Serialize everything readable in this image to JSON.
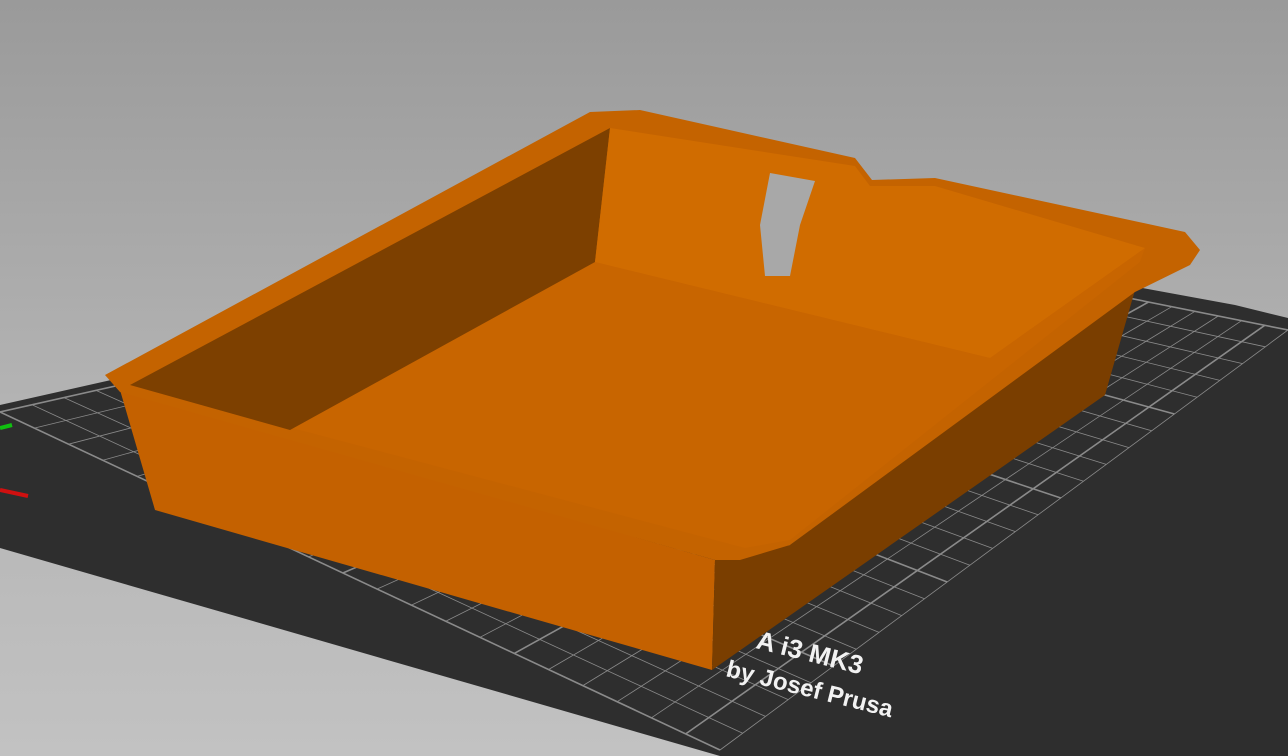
{
  "viewport": {
    "bed_label_line1": "A i3 MK3",
    "bed_label_line2": "by Josef Prusa"
  },
  "colors": {
    "background_top": "#9a9a9a",
    "bed": "#2f2f2f",
    "grid": "#8a8a8a",
    "model_light": "#cf6a00",
    "model_mid": "#bf5e00",
    "model_dark": "#7a3e00",
    "axis_x": "#d01010",
    "axis_y": "#10c010"
  }
}
